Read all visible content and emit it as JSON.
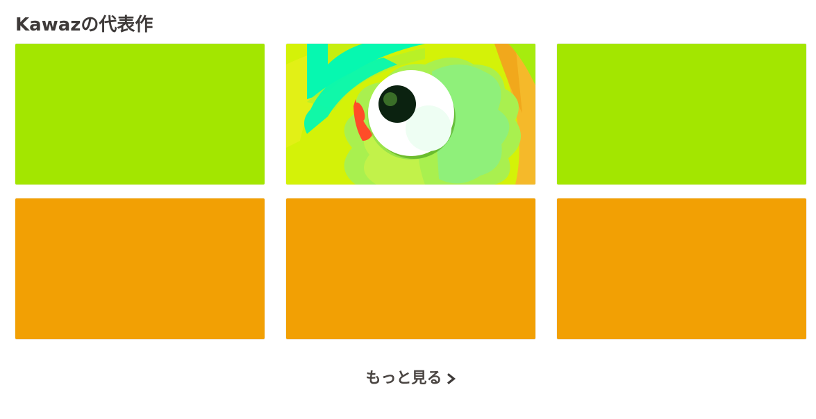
{
  "section": {
    "title": "Kawazの代表作",
    "more_label": "もっと見る"
  },
  "works": [
    {
      "thumb_color": "#a3e600",
      "has_artwork": false
    },
    {
      "thumb_color": "#d2f20a",
      "has_artwork": true
    },
    {
      "thumb_color": "#a3e600",
      "has_artwork": false
    },
    {
      "thumb_color": "#f2a004",
      "has_artwork": false
    },
    {
      "thumb_color": "#f2a004",
      "has_artwork": false
    },
    {
      "thumb_color": "#f2a004",
      "has_artwork": false
    }
  ],
  "icons": {
    "more": "chevron-right-icon"
  }
}
